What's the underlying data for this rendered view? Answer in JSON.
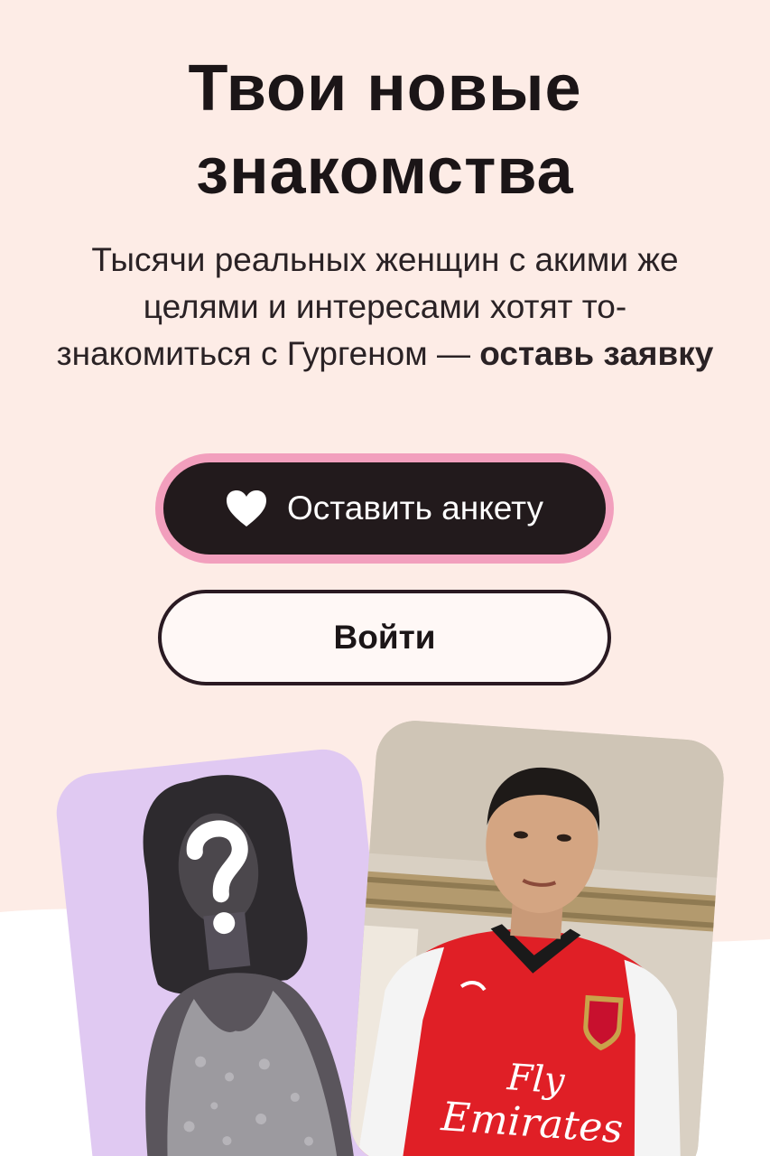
{
  "hero": {
    "title_line1": "Твои новые",
    "title_line2": "знакомства",
    "subtitle_text": "Тысячи реальных женщин с акими же целями и интересами хотят то-знакомиться с Гургеном —",
    "subtitle_bold": "оставь заявку"
  },
  "actions": {
    "primary_label": "Оставить анкету",
    "primary_icon": "heart-icon",
    "secondary_label": "Войти"
  },
  "cards": {
    "mystery_icon": "question-mark-icon",
    "photo_jersey_text_1": "Fly",
    "photo_jersey_text_2": "Emirates"
  },
  "colors": {
    "background": "#fdece6",
    "primary_button": "#221a1c",
    "primary_glow": "#f29fbd",
    "mystery_card": "#e0c9f2"
  }
}
